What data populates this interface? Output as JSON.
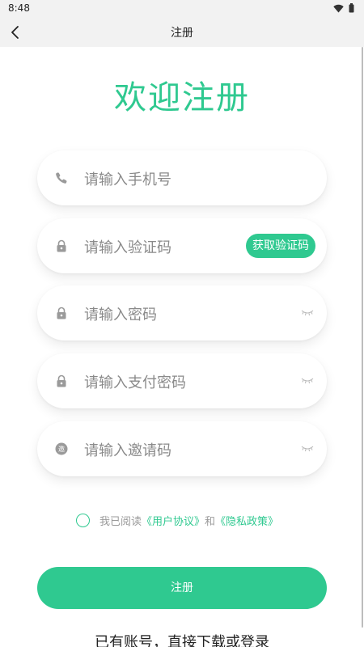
{
  "status_bar": {
    "time": "8:48"
  },
  "nav": {
    "title": "注册"
  },
  "heading": "欢迎注册",
  "fields": {
    "phone": {
      "placeholder": "请输入手机号"
    },
    "code": {
      "placeholder": "请输入验证码",
      "button": "获取验证码"
    },
    "password": {
      "placeholder": "请输入密码"
    },
    "pay_password": {
      "placeholder": "请输入支付密码"
    },
    "invite": {
      "placeholder": "请输入邀请码",
      "icon_text": "邀"
    }
  },
  "agreement": {
    "prefix": "我已阅读",
    "user_agreement": "《用户协议》",
    "and": "和",
    "privacy_policy": "《隐私政策》"
  },
  "submit": {
    "label": "注册"
  },
  "footer": {
    "login_link": "已有账号，直接下载或登录"
  },
  "colors": {
    "accent": "#2fc990",
    "placeholder": "#8a8a8a",
    "bar": "#f2f2f2"
  }
}
